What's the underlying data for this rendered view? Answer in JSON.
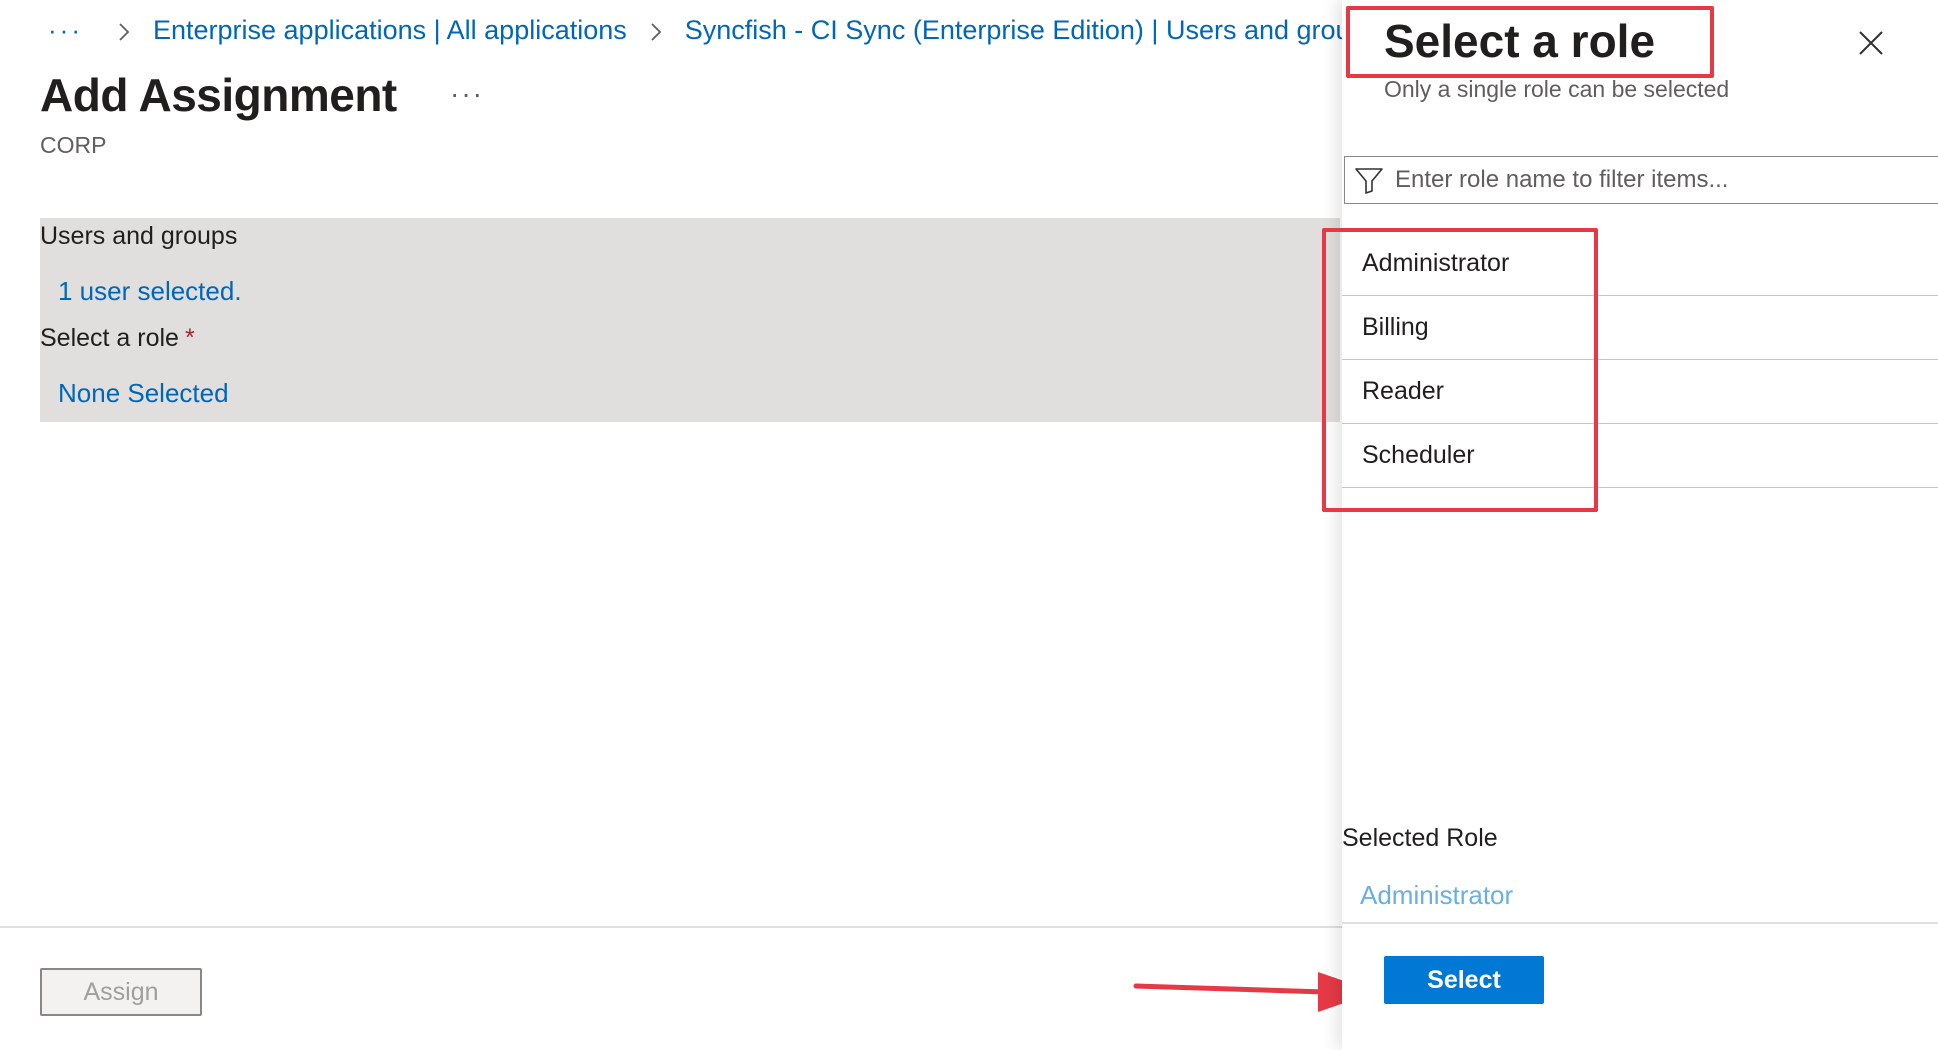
{
  "breadcrumb": {
    "more": "···",
    "items": [
      "Enterprise applications | All applications",
      "Syncfish - CI Sync (Enterprise Edition) | Users and groups"
    ]
  },
  "page": {
    "title": "Add Assignment",
    "more": "···",
    "subtitle": "CORP"
  },
  "form": {
    "users_label": "Users and groups",
    "users_value": "1 user selected.",
    "role_label": "Select a role",
    "required_marker": "*",
    "role_value": "None Selected"
  },
  "footer": {
    "assign_label": "Assign"
  },
  "panel": {
    "title": "Select a role",
    "subtitle": "Only a single role can be selected",
    "filter_placeholder": "Enter role name to filter items...",
    "roles": [
      "Administrator",
      "Billing",
      "Reader",
      "Scheduler"
    ],
    "selected_label": "Selected Role",
    "selected_value": "Administrator",
    "select_label": "Select"
  },
  "colors": {
    "link": "#0067b8",
    "primary_button": "#0078d4",
    "annotation": "#e63946",
    "selected_value": "#69afe5"
  }
}
